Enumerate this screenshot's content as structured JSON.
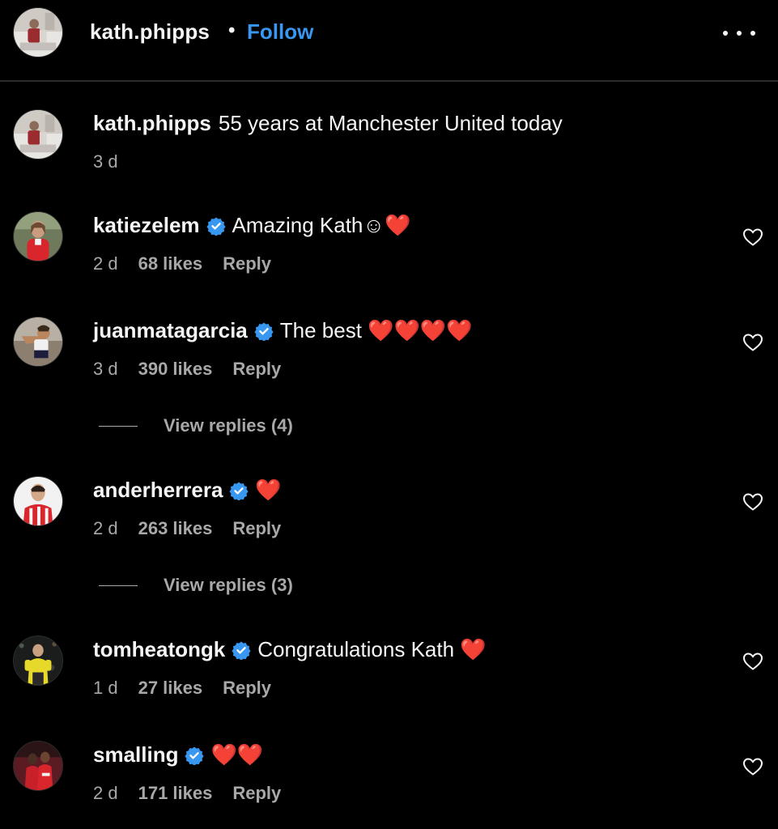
{
  "header": {
    "username": "kath.phipps",
    "separator": "•",
    "follow_label": "Follow"
  },
  "caption": {
    "username": "kath.phipps",
    "text": "55 years at Manchester United today",
    "age": "3 d"
  },
  "comments": [
    {
      "username": "katiezelem",
      "verified": true,
      "text": "Amazing Kath☺❤️",
      "age": "2 d",
      "likes": "68 likes",
      "reply": "Reply"
    },
    {
      "username": "juanmatagarcia",
      "verified": true,
      "text": "The best ❤️❤️❤️❤️",
      "age": "3 d",
      "likes": "390 likes",
      "reply": "Reply",
      "view_replies": "View replies (4)"
    },
    {
      "username": "anderherrera",
      "verified": true,
      "text": "❤️",
      "age": "2 d",
      "likes": "263 likes",
      "reply": "Reply",
      "view_replies": "View replies (3)"
    },
    {
      "username": "tomheatongk",
      "verified": true,
      "text": "Congratulations Kath ❤️",
      "age": "1 d",
      "likes": "27 likes",
      "reply": "Reply"
    },
    {
      "username": "smalling",
      "verified": true,
      "text": "❤️❤️",
      "age": "2 d",
      "likes": "171 likes",
      "reply": "Reply"
    }
  ],
  "colors": {
    "background": "#000000",
    "text": "#f5f5f5",
    "muted": "#a8a8a8",
    "link": "#3897f0",
    "verified": "#3897f0",
    "heart_emoji": "#ff2d3b"
  },
  "icons": [
    "more-options-icon",
    "verified-badge-icon",
    "heart-outline-icon",
    "red-heart-emoji"
  ]
}
